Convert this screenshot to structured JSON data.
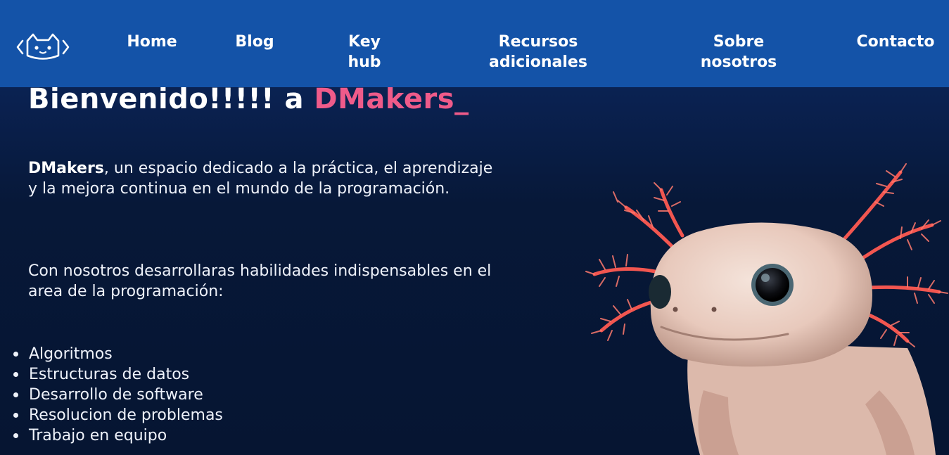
{
  "nav": {
    "logo_icon": "cat-code-brackets-icon",
    "items": [
      {
        "line1": "Home",
        "line2": ""
      },
      {
        "line1": "Blog",
        "line2": ""
      },
      {
        "line1": "Key",
        "line2": "hub"
      },
      {
        "line1": "Recursos",
        "line2": "adicionales"
      },
      {
        "line1": "Sobre",
        "line2": "nosotros"
      },
      {
        "line1": "Contacto",
        "line2": ""
      }
    ]
  },
  "hero": {
    "title_prefix": "Bienvenido!!!!! a ",
    "title_brand": "DMakers_",
    "intro_bold": "DMakers",
    "intro_rest": ", un espacio dedicado a la práctica, el aprendizaje y la mejora continua en el mundo de la programación.",
    "skills_intro": "Con nosotros desarrollaras habilidades indispensables en el area de la programación:",
    "skills": [
      "Algoritmos",
      "Estructuras de datos",
      "Desarrollo de software",
      "Resolucion de problemas",
      "Trabajo en equipo"
    ],
    "image_icon": "axolotl-illustration"
  },
  "colors": {
    "nav_bg": "#1453a8",
    "page_bg": "#061532",
    "brand_accent": "#ef5b8a",
    "text": "#ffffff"
  }
}
